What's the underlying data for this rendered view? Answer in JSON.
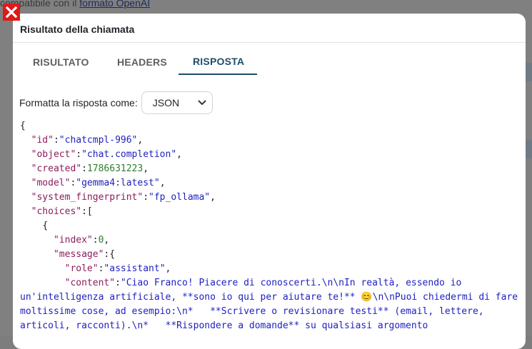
{
  "background": {
    "text_prefix": "compatibile con il ",
    "link_text": "formato OpenAI"
  },
  "modal": {
    "title": "Risultato della chiamata",
    "close_icon": "close-icon"
  },
  "tabs": [
    {
      "label": "RISULTATO",
      "active": false
    },
    {
      "label": "HEADERS",
      "active": false
    },
    {
      "label": "RISPOSTA",
      "active": true
    }
  ],
  "format": {
    "label": "Formatta la risposta come:",
    "selected": "JSON"
  },
  "json": {
    "open_brace": "{",
    "id_key": "\"id\"",
    "id_value": "\"chatcmpl-996\"",
    "object_key": "\"object\"",
    "object_value": "\"chat.completion\"",
    "created_key": "\"created\"",
    "created_value": "1786631223",
    "model_key": "\"model\"",
    "model_value": "\"gemma4:latest\"",
    "fingerprint_key": "\"system_fingerprint\"",
    "fingerprint_value": "\"fp_ollama\"",
    "choices_key": "\"choices\"",
    "index_key": "\"index\"",
    "index_value": "0",
    "message_key": "\"message\"",
    "role_key": "\"role\"",
    "role_value": "\"assistant\"",
    "content_key": "\"content\"",
    "content_value": "\"Ciao Franco! Piacere di conoscerti.\\n\\nIn realtà, essendo io un'intelligenza artificiale, **sono io qui per aiutare te!** 😊\\n\\nPuoi chiedermi di fare moltissime cose, ad esempio:\\n*   **Scrivere o revisionare testi** (email, lettere, articoli, racconti).\\n*   **Rispondere a domande** su qualsiasi argomento"
  },
  "colors": {
    "tab_active": "#1d4d6b",
    "json_key": "#8b1d5b",
    "json_string": "#1d1fbf",
    "json_number": "#2e7d2e",
    "close_button": "#e01919"
  }
}
